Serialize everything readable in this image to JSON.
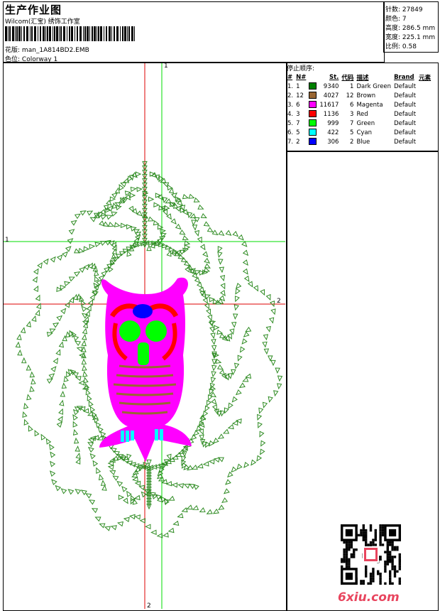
{
  "header": {
    "title": "生产作业图",
    "subtitle": "Wilcom(汇宝) 绣饰工作室",
    "design_label": "花版:",
    "design_file": "man_1A814BD2.EMB",
    "colorway_label": "色位:",
    "colorway": "Colorway 1"
  },
  "info": [
    {
      "label": "针数:",
      "value": "27849"
    },
    {
      "label": "颜色:",
      "value": "7"
    },
    {
      "label": "高度:",
      "value": "286.5 mm"
    },
    {
      "label": "宽度:",
      "value": "225.1 mm"
    },
    {
      "label": "比例:",
      "value": "0.58"
    }
  ],
  "stops": {
    "heading": "停止顺序:",
    "columns": [
      "#",
      "N#",
      "St.",
      "代码",
      "描述",
      "Brand",
      "元素"
    ],
    "rows": [
      {
        "idx": "1.",
        "n": "1",
        "st": "9340",
        "code": "1",
        "desc": "Dark Green",
        "brand": "Default",
        "color": "#008000"
      },
      {
        "idx": "2.",
        "n": "12",
        "st": "4027",
        "code": "12",
        "desc": "Brown",
        "brand": "Default",
        "color": "#996633"
      },
      {
        "idx": "3.",
        "n": "6",
        "st": "11617",
        "code": "6",
        "desc": "Magenta",
        "brand": "Default",
        "color": "#ff00ff"
      },
      {
        "idx": "4.",
        "n": "3",
        "st": "1136",
        "code": "3",
        "desc": "Red",
        "brand": "Default",
        "color": "#ff0000"
      },
      {
        "idx": "5.",
        "n": "7",
        "st": "999",
        "code": "7",
        "desc": "Green",
        "brand": "Default",
        "color": "#00ff00"
      },
      {
        "idx": "6.",
        "n": "5",
        "st": "422",
        "code": "5",
        "desc": "Cyan",
        "brand": "Default",
        "color": "#00ffff"
      },
      {
        "idx": "7.",
        "n": "2",
        "st": "306",
        "code": "2",
        "desc": "Blue",
        "brand": "Default",
        "color": "#0000ff"
      }
    ]
  },
  "guides": {
    "green_v": "1",
    "green_h": "1",
    "red_h": "2",
    "red_v": "2"
  },
  "watermark": "6xiu.com",
  "colors": {
    "frame": "#2e8b22",
    "owl_body": "#ff00ff",
    "eye": "#00ff00",
    "beak": "#00ff00",
    "brown": "#996633",
    "red": "#ff0000",
    "blue": "#0000ff",
    "cyan": "#00ffff",
    "guide_green": "#00dd00",
    "guide_red": "#dd0000"
  }
}
